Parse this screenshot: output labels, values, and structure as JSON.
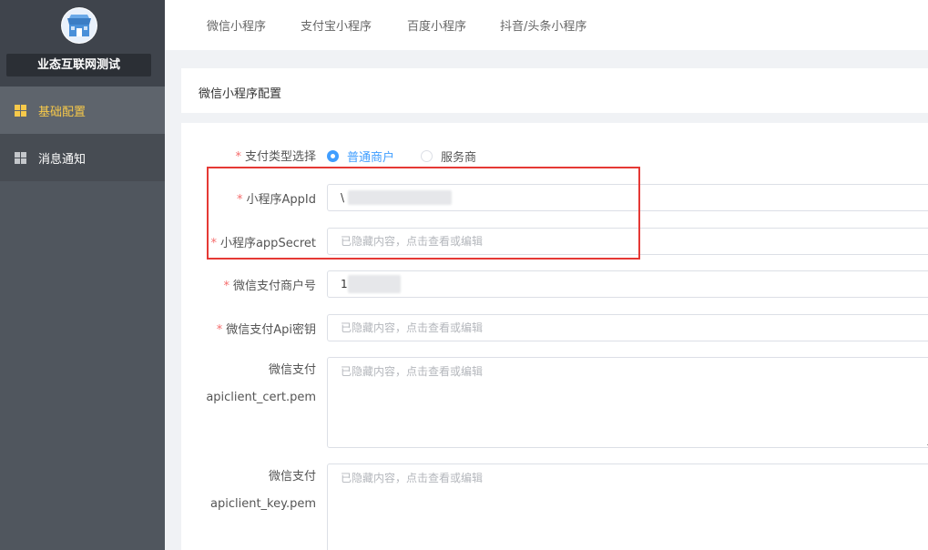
{
  "sidebar": {
    "shop_name": "业态互联网测试",
    "logo_icon": "store-icon",
    "items": [
      {
        "label": "基础配置",
        "icon": "grid-icon",
        "active": true
      },
      {
        "label": "消息通知",
        "icon": "grid-icon",
        "active": false
      }
    ]
  },
  "tabs": [
    {
      "label": "微信小程序"
    },
    {
      "label": "支付宝小程序"
    },
    {
      "label": "百度小程序"
    },
    {
      "label": "抖音/头条小程序"
    }
  ],
  "section": {
    "title": "微信小程序配置"
  },
  "form": {
    "pay_type": {
      "label": "支付类型选择",
      "options": [
        {
          "label": "普通商户",
          "checked": true
        },
        {
          "label": "服务商",
          "checked": false
        }
      ]
    },
    "appid": {
      "label": "小程序AppId",
      "value": "\\"
    },
    "appsecret": {
      "label": "小程序appSecret",
      "placeholder": "已隐藏内容，点击查看或编辑"
    },
    "mch_id": {
      "label": "微信支付商户号",
      "value": "1"
    },
    "api_key": {
      "label": "微信支付Api密钥",
      "placeholder": "已隐藏内容，点击查看或编辑"
    },
    "cert": {
      "label_line1": "微信支付",
      "label_line2": "apiclient_cert.pem",
      "placeholder": "已隐藏内容，点击查看或编辑"
    },
    "key": {
      "label_line1": "微信支付",
      "label_line2": "apiclient_key.pem",
      "placeholder": "已隐藏内容，点击查看或编辑"
    }
  },
  "colors": {
    "sidebar_bg": "#50565e",
    "active_accent": "#f7c94a",
    "primary_blue": "#409eff",
    "required_red": "#f56c6c",
    "annotation_red": "#e53935"
  }
}
